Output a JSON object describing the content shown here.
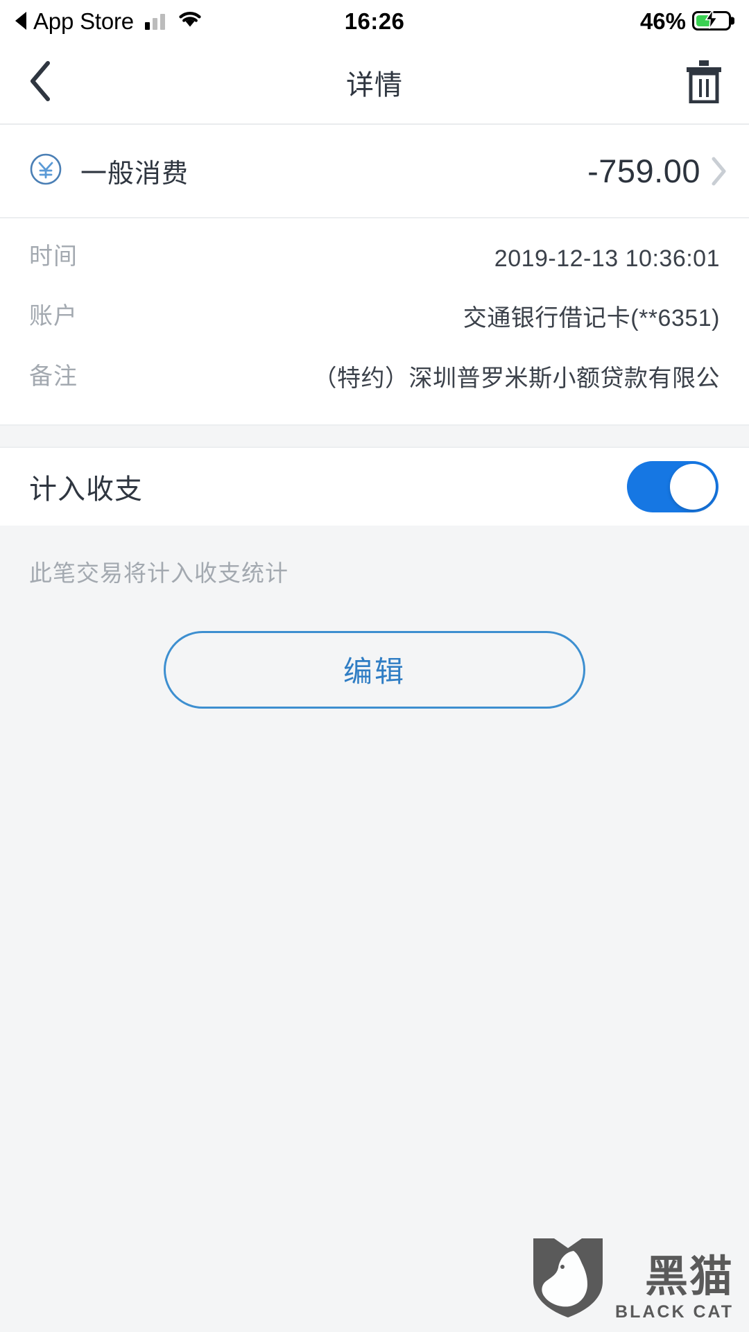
{
  "status_bar": {
    "back_label": "App Store",
    "back_icon": "triangle-left-icon",
    "signal_icon": "cellular-signal-icon",
    "wifi_icon": "wifi-icon",
    "time": "16:26",
    "battery_percent": "46%",
    "battery_icon": "battery-charging-icon",
    "battery_level": 46,
    "battery_color": "#3ad152"
  },
  "nav": {
    "back_icon": "chevron-left-icon",
    "title": "详情",
    "delete_icon": "trash-icon"
  },
  "transaction": {
    "category_icon": "yen-circle-icon",
    "category": "一般消费",
    "amount": "-759.00",
    "chevron_icon": "chevron-right-icon",
    "rows": [
      {
        "label": "时间",
        "value": "2019-12-13 10:36:01"
      },
      {
        "label": "账户",
        "value": "交通银行借记卡(**6351)"
      },
      {
        "label": "备注",
        "value": "（特约）深圳普罗米斯小额贷款有限公"
      }
    ]
  },
  "include_toggle": {
    "label": "计入收支",
    "state": "on",
    "hint": "此笔交易将计入收支统计",
    "accent_color": "#1677e3"
  },
  "actions": {
    "edit_label": "编辑",
    "edit_color": "#2f7dc4"
  },
  "watermark": {
    "logo_icon": "black-cat-shield-icon",
    "name_cn": "黑猫",
    "name_en": "BLACK CAT"
  }
}
